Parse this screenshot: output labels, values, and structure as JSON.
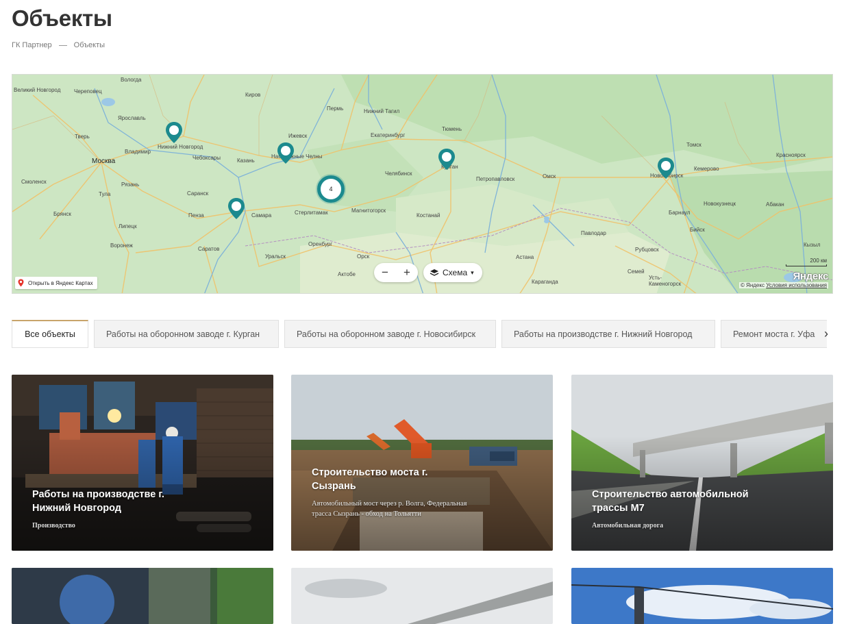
{
  "page": {
    "title": "Объекты"
  },
  "breadcrumb": {
    "home": "ГК Партнер",
    "current": "Объекты"
  },
  "map": {
    "cities": [
      {
        "name": "Великий Новгород"
      },
      {
        "name": "Вологда"
      },
      {
        "name": "Череповец"
      },
      {
        "name": "Киров"
      },
      {
        "name": "Ярославль"
      },
      {
        "name": "Тверь"
      },
      {
        "name": "Москва"
      },
      {
        "name": "Владимир"
      },
      {
        "name": "Нижний Новгород"
      },
      {
        "name": "Чебоксары"
      },
      {
        "name": "Казань"
      },
      {
        "name": "Смоленск"
      },
      {
        "name": "Рязань"
      },
      {
        "name": "Тула"
      },
      {
        "name": "Брянск"
      },
      {
        "name": "Липецк"
      },
      {
        "name": "Воронеж"
      },
      {
        "name": "Саранск"
      },
      {
        "name": "Пенза"
      },
      {
        "name": "Саратов"
      },
      {
        "name": "Самара"
      },
      {
        "name": "Ижевск"
      },
      {
        "name": "Набережные Челны"
      },
      {
        "name": "Пермь"
      },
      {
        "name": "Нижний Тагил"
      },
      {
        "name": "Екатеринбург"
      },
      {
        "name": "Тюмень"
      },
      {
        "name": "Курган"
      },
      {
        "name": "Челябинск"
      },
      {
        "name": "Магнитогорск"
      },
      {
        "name": "Стерлитамак"
      },
      {
        "name": "Оренбург"
      },
      {
        "name": "Уральск"
      },
      {
        "name": "Орск"
      },
      {
        "name": "Актобе"
      },
      {
        "name": "Костанай"
      },
      {
        "name": "Петропавловск"
      },
      {
        "name": "Омск"
      },
      {
        "name": "Астана"
      },
      {
        "name": "Караганда"
      },
      {
        "name": "Павлодар"
      },
      {
        "name": "Новосибирск"
      },
      {
        "name": "Томск"
      },
      {
        "name": "Кемерово"
      },
      {
        "name": "Новокузнецк"
      },
      {
        "name": "Барнаул"
      },
      {
        "name": "Бийск"
      },
      {
        "name": "Рубцовск"
      },
      {
        "name": "Семей"
      },
      {
        "name": "Усть-Каменогорск"
      },
      {
        "name": "Красноярск"
      },
      {
        "name": "Абакан"
      },
      {
        "name": "Кызыл"
      }
    ],
    "cluster_count": "4",
    "zoom_out": "−",
    "zoom_in": "+",
    "layer_label": "Схема",
    "layer_caret": "▾",
    "open_link": "Открыть в Яндекс Картах",
    "scale_label": "200 км",
    "logo": "Яндекс",
    "copyright": "© Яндекс",
    "terms": "Условия использования"
  },
  "tabs": [
    {
      "label": "Все объекты",
      "active": true
    },
    {
      "label": "Работы на оборонном заводе г. Курган"
    },
    {
      "label": "Работы на оборонном заводе г. Новосибирск"
    },
    {
      "label": "Работы на производстве г. Нижний Новгород"
    },
    {
      "label": "Ремонт моста г. Уфа"
    }
  ],
  "tabs_next": "›",
  "cards": [
    {
      "title": "Работы на производстве г. Нижний Новгород",
      "subtitle": "",
      "category": "Производство"
    },
    {
      "title": "Строительство моста г. Сызрань",
      "subtitle": "Автомобильный мост через р. Волга, Федеральная трасса Сызрань - обход на Тольятти",
      "category": ""
    },
    {
      "title": "Строительство автомобильной трассы М7",
      "subtitle": "",
      "category": "Автомобильная дорога"
    }
  ],
  "colors": {
    "accent": "#1c8a8e",
    "tab_active_border": "#c8a46a"
  }
}
